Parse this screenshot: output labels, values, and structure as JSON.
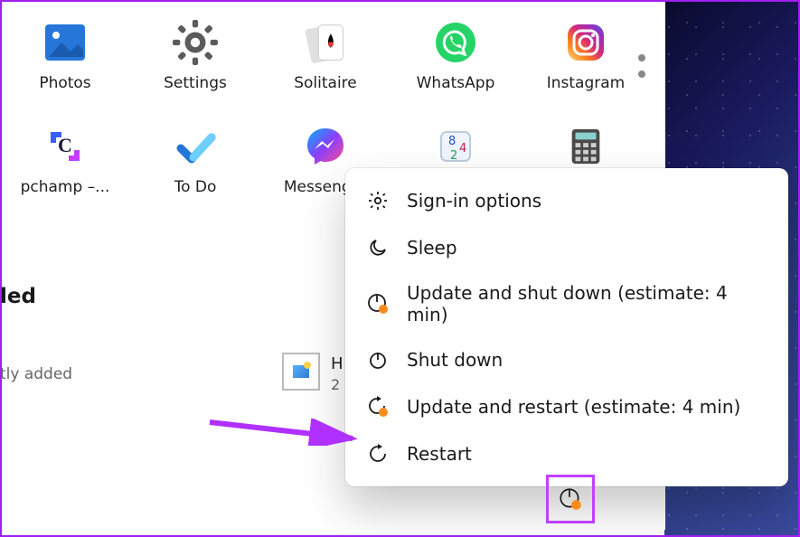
{
  "apps": {
    "row1": [
      {
        "name": "photos",
        "label": "Photos"
      },
      {
        "name": "settings",
        "label": "Settings"
      },
      {
        "name": "solitaire",
        "label": "Solitaire"
      },
      {
        "name": "whatsapp",
        "label": "WhatsApp"
      },
      {
        "name": "instagram",
        "label": "Instagram"
      }
    ],
    "row2": [
      {
        "name": "clipchamp",
        "label": "pchamp –..."
      },
      {
        "name": "todo",
        "label": "To Do"
      },
      {
        "name": "messenger",
        "label": "Messenger"
      },
      {
        "name": "snip",
        "label": ""
      },
      {
        "name": "calculator",
        "label": ""
      }
    ]
  },
  "section_heading": "led",
  "recent": {
    "subtitle": "tly added",
    "initial": "H",
    "second": "2"
  },
  "power_menu": {
    "signin": "Sign-in options",
    "sleep": "Sleep",
    "update_shutdown": "Update and shut down (estimate: 4 min)",
    "shutdown": "Shut down",
    "update_restart": "Update and restart (estimate: 4 min)",
    "restart": "Restart"
  }
}
